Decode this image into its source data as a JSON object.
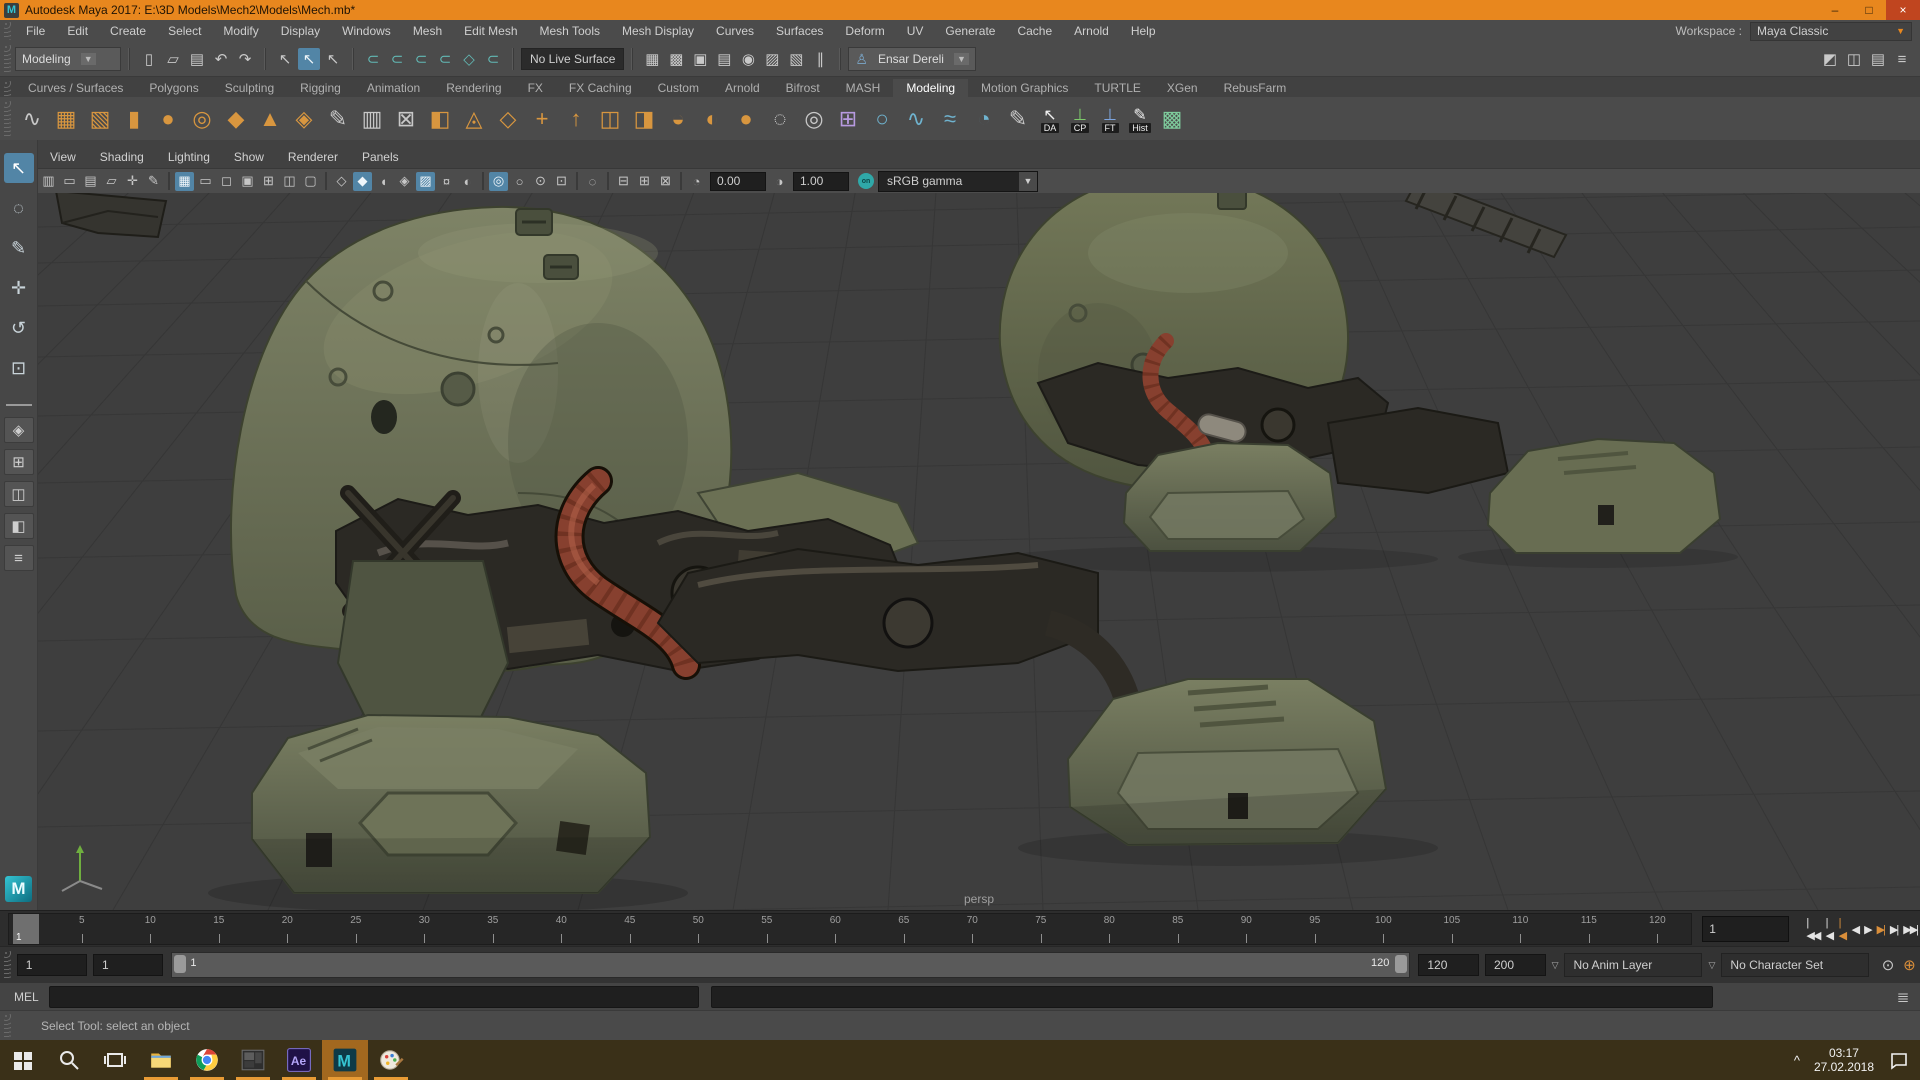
{
  "window": {
    "title": "Autodesk Maya 2017: E:\\3D Models\\Mech2\\Models\\Mech.mb*",
    "controls": {
      "minimize": "–",
      "maximize": "□",
      "close": "×"
    }
  },
  "menu_bar": {
    "items": [
      "File",
      "Edit",
      "Create",
      "Select",
      "Modify",
      "Display",
      "Windows",
      "Mesh",
      "Edit Mesh",
      "Mesh Tools",
      "Mesh Display",
      "Curves",
      "Surfaces",
      "Deform",
      "UV",
      "Generate",
      "Cache",
      "Arnold",
      "Help"
    ],
    "workspace_label": "Workspace :",
    "workspace_value": "Maya Classic"
  },
  "status_line": {
    "menu_set": "Modeling",
    "live_surface": "No Live Surface",
    "user_name": "Ensar Dereli",
    "groups": [
      {
        "name": "file",
        "icons": [
          {
            "n": "new-scene",
            "g": "▯"
          },
          {
            "n": "open-scene",
            "g": "▱"
          },
          {
            "n": "save-scene",
            "g": "▤"
          },
          {
            "n": "undo",
            "g": "↶"
          },
          {
            "n": "redo",
            "g": "↷"
          }
        ]
      },
      {
        "name": "selection-masks",
        "icons": [
          {
            "n": "select-by-hierarchy",
            "g": "↖"
          },
          {
            "n": "select-by-object",
            "g": "↖",
            "active": true
          },
          {
            "n": "select-by-component",
            "g": "↖"
          }
        ]
      },
      {
        "name": "snapping",
        "icons": [
          {
            "n": "snap-to-grids",
            "g": "⊂",
            "teal": true
          },
          {
            "n": "snap-to-curves",
            "g": "⊂",
            "teal": true
          },
          {
            "n": "snap-to-points",
            "g": "⊂",
            "teal": true
          },
          {
            "n": "snap-to-projected-center",
            "g": "⊂",
            "teal": true
          },
          {
            "n": "make-live",
            "g": "◇",
            "teal": true
          },
          {
            "n": "snap-to-view-planes",
            "g": "⊂",
            "teal": true
          }
        ]
      },
      {
        "name": "rendering",
        "icons": [
          {
            "n": "open-render-view",
            "g": "▦"
          },
          {
            "n": "render-current-frame",
            "g": "▩"
          },
          {
            "n": "ipr-render",
            "g": "▣"
          },
          {
            "n": "render-settings",
            "g": "▤"
          },
          {
            "n": "hypershade",
            "g": "◉"
          },
          {
            "n": "render-setup",
            "g": "▨"
          },
          {
            "n": "launch-sequence-render",
            "g": "▧"
          },
          {
            "n": "pause-viewport-update",
            "g": "∥"
          }
        ]
      }
    ],
    "right_icons": [
      {
        "n": "modeling-toolkit-toggle",
        "g": "◩"
      },
      {
        "n": "attribute-editor-toggle",
        "g": "◫"
      },
      {
        "n": "tool-settings-toggle",
        "g": "▤"
      },
      {
        "n": "channel-box-toggle",
        "g": "≡"
      }
    ]
  },
  "shelf": {
    "tabs": [
      {
        "label": "Curves / Surfaces"
      },
      {
        "label": "Polygons"
      },
      {
        "label": "Sculpting"
      },
      {
        "label": "Rigging"
      },
      {
        "label": "Animation"
      },
      {
        "label": "Rendering"
      },
      {
        "label": "FX"
      },
      {
        "label": "FX Caching"
      },
      {
        "label": "Custom"
      },
      {
        "label": "Arnold"
      },
      {
        "label": "Bifrost"
      },
      {
        "label": "MASH"
      },
      {
        "label": "Modeling",
        "active": true
      },
      {
        "label": "Motion Graphics"
      },
      {
        "label": "TURTLE"
      },
      {
        "label": "XGen"
      },
      {
        "label": "RebusFarm"
      }
    ],
    "icons": [
      {
        "n": "ep-curve-tool",
        "g": "∿",
        "c": "#c8c8c8"
      },
      {
        "n": "poly-super-shape",
        "g": "▦",
        "c": "#d8963f"
      },
      {
        "n": "poly-cube",
        "g": "▧",
        "c": "#d8963f"
      },
      {
        "n": "poly-cylinder",
        "g": "▮",
        "c": "#d8963f"
      },
      {
        "n": "poly-sphere",
        "g": "●",
        "c": "#d8963f"
      },
      {
        "n": "poly-torus",
        "g": "◎",
        "c": "#d8963f"
      },
      {
        "n": "poly-plane",
        "g": "◆",
        "c": "#d8963f"
      },
      {
        "n": "poly-cone",
        "g": "▲",
        "c": "#d8963f"
      },
      {
        "n": "poly-pipe",
        "g": "◈",
        "c": "#d8963f"
      },
      {
        "n": "slide-edge-tool",
        "g": "✎",
        "c": "#c8c8c8"
      },
      {
        "n": "multi-cut-tool",
        "g": "▥",
        "c": "#c8c8c8"
      },
      {
        "n": "target-weld-tool",
        "g": "⊠",
        "c": "#c8c8c8"
      },
      {
        "n": "boolean-union",
        "g": "◧",
        "c": "#d8963f"
      },
      {
        "n": "boolean-difference",
        "g": "◬",
        "c": "#d8963f"
      },
      {
        "n": "quad-draw-tool",
        "g": "◇",
        "c": "#d8963f"
      },
      {
        "n": "relax-vertices",
        "g": "+",
        "c": "#d8963f"
      },
      {
        "n": "extrude",
        "g": "↑",
        "c": "#d8963f"
      },
      {
        "n": "bridge",
        "g": "◫",
        "c": "#d8963f"
      },
      {
        "n": "bevel",
        "g": "◨",
        "c": "#d8963f"
      },
      {
        "n": "smooth",
        "g": "◒",
        "c": "#d8963f"
      },
      {
        "n": "mirror",
        "g": "◐",
        "c": "#d8963f"
      },
      {
        "n": "sculpt-tool",
        "g": "●",
        "c": "#d8963f"
      },
      {
        "n": "smooth-mesh-preview",
        "g": "◌",
        "c": "#c8c8c8"
      },
      {
        "n": "edit-pivot",
        "g": "◎",
        "c": "#c8c8c8"
      },
      {
        "n": "lattice-deformer",
        "g": "⊞",
        "c": "#b79ae0"
      },
      {
        "n": "nurbs-circle",
        "g": "○",
        "c": "#6fb3cf"
      },
      {
        "n": "pencil-curve-tool",
        "g": "∿",
        "c": "#6fb3cf"
      },
      {
        "n": "attach-curves",
        "g": "≈",
        "c": "#6fb3cf"
      },
      {
        "n": "revolve",
        "g": "◔",
        "c": "#6fb3cf"
      },
      {
        "n": "freeform-fillet",
        "g": "✎",
        "c": "#c8c8c8"
      },
      {
        "n": "delete-attributes",
        "g": "↖",
        "c": "#f0f0f0",
        "label": "DA"
      },
      {
        "n": "center-pivot",
        "g": "⊥",
        "c": "#7ecb6c",
        "label": "CP"
      },
      {
        "n": "freeze-transformations",
        "g": "⊥",
        "c": "#7ea6e0",
        "label": "FT"
      },
      {
        "n": "delete-history",
        "g": "✎",
        "c": "#f0f0f0",
        "label": "Hist"
      },
      {
        "n": "checker-texture",
        "g": "▩",
        "c": "#7ecb9c"
      }
    ]
  },
  "panel": {
    "menus": [
      "View",
      "Shading",
      "Lighting",
      "Show",
      "Renderer",
      "Panels"
    ],
    "toolbar_icons": [
      {
        "n": "select-camera",
        "g": "▥"
      },
      {
        "n": "camera-attributes",
        "g": "▭"
      },
      {
        "n": "camera-bookmarks",
        "g": "▤"
      },
      {
        "n": "image-plane",
        "g": "▱"
      },
      {
        "n": "2d-pan-zoom",
        "g": "✛"
      },
      {
        "n": "greasepencil",
        "g": "✎"
      },
      {
        "sep": true
      },
      {
        "n": "grid-toggle",
        "g": "▦",
        "active": true
      },
      {
        "n": "film-gate",
        "g": "▭"
      },
      {
        "n": "resolution-gate",
        "g": "◻"
      },
      {
        "n": "gate-mask",
        "g": "▣"
      },
      {
        "n": "field-chart",
        "g": "⊞"
      },
      {
        "n": "safe-action",
        "g": "◫"
      },
      {
        "n": "safe-title",
        "g": "▢"
      },
      {
        "sep": true
      },
      {
        "n": "wireframe-display",
        "g": "◇"
      },
      {
        "n": "smooth-shade-display",
        "g": "◆",
        "active": true
      },
      {
        "n": "flat-shade-display",
        "g": "◖"
      },
      {
        "n": "bounding-box-display",
        "g": "◈"
      },
      {
        "n": "textured-display",
        "g": "▨",
        "active": true
      },
      {
        "n": "use-all-lights",
        "g": "¤"
      },
      {
        "n": "shadows-toggle",
        "g": "◐"
      },
      {
        "sep": true
      },
      {
        "n": "screen-space-ao",
        "g": "◎",
        "active": true
      },
      {
        "n": "motion-blur-toggle",
        "g": "○"
      },
      {
        "n": "multisample-aa",
        "g": "⊙"
      },
      {
        "n": "isolate-select",
        "g": "⊡"
      },
      {
        "sep": true
      },
      {
        "n": "xray-display",
        "g": "◌"
      },
      {
        "sep": true
      },
      {
        "n": "tear-off-copy",
        "g": "⊟"
      },
      {
        "n": "duplicate-pane",
        "g": "⊞"
      },
      {
        "n": "pane-settings",
        "g": "⊠"
      },
      {
        "sep": true
      },
      {
        "n": "exposure-toggle",
        "g": "◔"
      }
    ],
    "exposure": "0.00",
    "gamma": "1.00",
    "gamma_icon": "◑",
    "view_transform": "sRGB gamma",
    "camera_label": "persp"
  },
  "toolbox": {
    "tools": [
      {
        "n": "select-tool",
        "g": "↖",
        "active": true
      },
      {
        "n": "lasso-select-tool",
        "g": "◌"
      },
      {
        "n": "paint-select-tool",
        "g": "✎"
      },
      {
        "n": "move-tool",
        "g": "✛"
      },
      {
        "n": "rotate-tool",
        "g": "↺"
      },
      {
        "n": "scale-tool",
        "g": "⊡"
      }
    ],
    "layouts": [
      {
        "n": "single-pane-layout",
        "g": "◈"
      },
      {
        "n": "four-pane-layout",
        "g": "⊞"
      },
      {
        "n": "two-pane-side-layout",
        "g": "◫"
      },
      {
        "n": "persp-outliner-layout",
        "g": "◧"
      },
      {
        "n": "outliner-list-layout",
        "g": "≡"
      }
    ]
  },
  "timeline": {
    "tick_labels": [
      5,
      10,
      15,
      20,
      25,
      30,
      35,
      40,
      45,
      50,
      55,
      60,
      65,
      70,
      75,
      80,
      85,
      90,
      95,
      100,
      105,
      110,
      115,
      120
    ],
    "current_frame": "1",
    "frame_field": "1",
    "playback": [
      {
        "n": "go-to-start",
        "g": "|◀◀"
      },
      {
        "n": "step-back-frame",
        "g": "|◀"
      },
      {
        "n": "step-back-key",
        "g": "|◀",
        "key": true
      },
      {
        "n": "play-backwards",
        "g": "◀"
      },
      {
        "n": "play-forwards",
        "g": "▶"
      },
      {
        "n": "step-forward-key",
        "g": "▶|",
        "key": true
      },
      {
        "n": "step-forward-frame",
        "g": "▶|"
      },
      {
        "n": "go-to-end",
        "g": "▶▶|"
      }
    ]
  },
  "range_slider": {
    "animation_start": "1",
    "playback_start": "1",
    "range_label_start": "1",
    "range_label_end": "120",
    "playback_end": "120",
    "animation_end": "200",
    "anim_layer": "No Anim Layer",
    "character_set": "No Character Set"
  },
  "command_line": {
    "label": "MEL",
    "input_value": "",
    "result_value": ""
  },
  "help_line": {
    "message": "Select Tool: select an object"
  },
  "taskbar": {
    "apps": [
      {
        "name": "start-button"
      },
      {
        "name": "search-button"
      },
      {
        "name": "task-view-button"
      },
      {
        "name": "file-explorer",
        "open": true
      },
      {
        "name": "chrome",
        "open": true
      },
      {
        "name": "photos",
        "open": true
      },
      {
        "name": "after-effects",
        "open": true
      },
      {
        "name": "maya",
        "open": true,
        "current": true
      },
      {
        "name": "paint",
        "open": true
      }
    ],
    "tray_chevron": "^",
    "clock_time": "03:17",
    "clock_date": "27.02.2018"
  }
}
